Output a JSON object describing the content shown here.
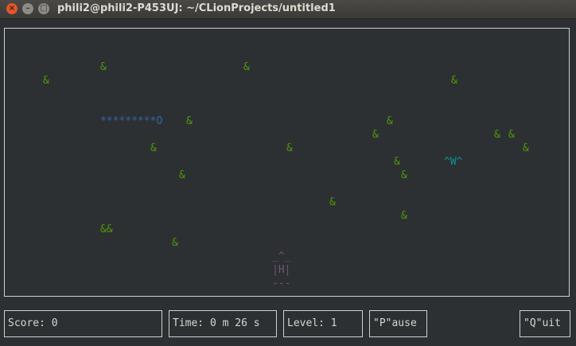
{
  "window": {
    "title": "phili2@phili2-P453UJ: ~/CLionProjects/untitled1"
  },
  "controls": {
    "close": "×",
    "minimize": "–",
    "maximize": "□"
  },
  "colors": {
    "food": "#4e9a06",
    "snake": "#3465a4",
    "enemy": "#06989a",
    "player": "#75507b",
    "border": "#cfcfcf"
  },
  "game": {
    "food_glyph": "&",
    "double_food": "&&",
    "snake": "*********O",
    "enemy": "^W^",
    "player": {
      "top": "_^_",
      "mid": "|H|",
      "bottom": "---"
    }
  },
  "status": {
    "score": "Score: 0",
    "time": "Time: 0 m 26 s",
    "level": "Level: 1",
    "pause": "\"P\"ause",
    "quit": "\"Q\"uit"
  }
}
